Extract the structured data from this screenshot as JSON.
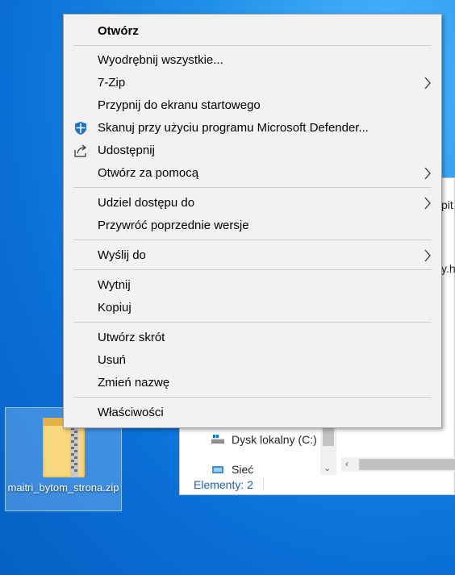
{
  "desktop": {
    "icon_label": "maitri_bytom_strona.zip"
  },
  "explorer": {
    "fragment_top": "pit",
    "fragment_mid": "y.ht",
    "nav_disk": "Dysk lokalny (C:)",
    "nav_network": "Sieć",
    "status": "Elementy: 2"
  },
  "menu": {
    "open": "Otwórz",
    "extract_all": "Wyodrębnij wszystkie...",
    "sevenzip": "7-Zip",
    "pin_start": "Przypnij do ekranu startowego",
    "defender_scan": "Skanuj przy użyciu programu Microsoft Defender...",
    "share": "Udostępnij",
    "open_with": "Otwórz za pomocą",
    "give_access": "Udziel dostępu do",
    "restore_versions": "Przywróć poprzednie wersje",
    "send_to": "Wyślij do",
    "cut": "Wytnij",
    "copy": "Kopiuj",
    "create_shortcut": "Utwórz skrót",
    "delete": "Usuń",
    "rename": "Zmień nazwę",
    "properties": "Właściwości"
  }
}
